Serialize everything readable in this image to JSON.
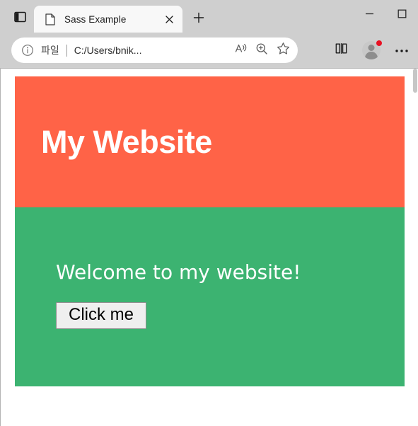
{
  "browser": {
    "sidebar_toggle_icon": "sidebar-toggle-icon",
    "tab": {
      "favicon": "page-document-icon",
      "title": "Sass Example",
      "close_icon": "close-icon"
    },
    "new_tab_icon": "plus-icon",
    "window_controls": {
      "minimize_icon": "minimize-icon",
      "maximize_icon": "maximize-icon"
    },
    "omnibox": {
      "info_icon": "info-circle-icon",
      "scheme_label": "파일",
      "url": "C:/Users/bnik...",
      "read_aloud_icon": "read-aloud-icon",
      "zoom_icon": "zoom-magnifier-icon",
      "favorite_icon": "star-icon"
    },
    "toolbar_right": {
      "split_screen_icon": "split-screen-icon",
      "profile_icon": "profile-avatar-icon",
      "settings_icon": "ellipsis-more-icon"
    }
  },
  "page": {
    "header": {
      "title": "My Website",
      "background": "#ff6347"
    },
    "main": {
      "welcome": "Welcome to my website!",
      "button_label": "Click me",
      "background": "#3cb371"
    }
  }
}
